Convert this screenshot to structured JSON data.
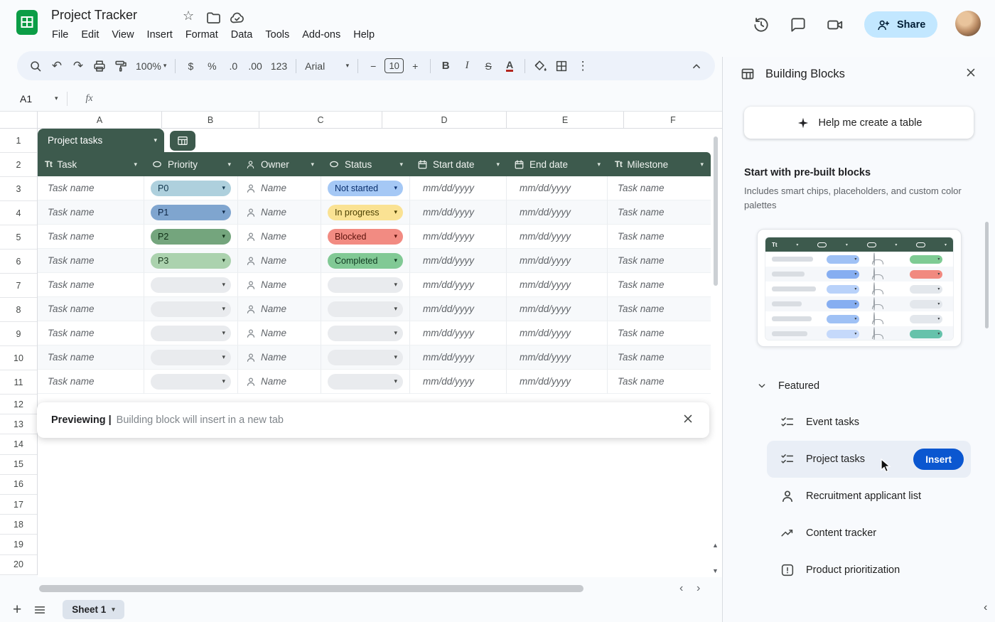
{
  "app": {
    "title": "Project Tracker",
    "menus": [
      "File",
      "Edit",
      "View",
      "Insert",
      "Format",
      "Data",
      "Tools",
      "Add-ons",
      "Help"
    ],
    "share": "Share"
  },
  "toolbar": {
    "zoom": "100%",
    "currency": "$",
    "percent": "%",
    "decrease_decimals": ".0",
    "increase_decimals": ".00",
    "more_formats": "123",
    "font": "Arial",
    "font_size": "10",
    "bold": "B",
    "italic": "I",
    "strikethrough": "S",
    "text_color": "A",
    "more": "⋮",
    "minus": "−",
    "plus": "+"
  },
  "formula_bar": {
    "cell": "A1",
    "fx": "fx"
  },
  "grid": {
    "columns": [
      "A",
      "B",
      "C",
      "D",
      "E",
      "F"
    ],
    "rows": [
      "1",
      "2",
      "3",
      "4",
      "5",
      "6",
      "7",
      "8",
      "9",
      "10",
      "11",
      "12",
      "13",
      "14",
      "15",
      "16",
      "17",
      "18",
      "19",
      "20"
    ]
  },
  "table": {
    "name": "Project tasks",
    "headers": [
      {
        "icon": "text",
        "label": "Task"
      },
      {
        "icon": "chip",
        "label": "Priority"
      },
      {
        "icon": "person",
        "label": "Owner"
      },
      {
        "icon": "chip",
        "label": "Status"
      },
      {
        "icon": "calendar",
        "label": "Start date"
      },
      {
        "icon": "calendar",
        "label": "End date"
      },
      {
        "icon": "text",
        "label": "Milestone"
      }
    ],
    "rows": [
      {
        "task": "Task name",
        "priority": {
          "label": "P0",
          "bg": "#aed0dd",
          "fg": "#12374e"
        },
        "owner": "Name",
        "status": {
          "label": "Not started",
          "bg": "#a5c8f5",
          "fg": "#0a2f6d"
        },
        "start": "mm/dd/yyyy",
        "end": "mm/dd/yyyy",
        "milestone": "Task name"
      },
      {
        "task": "Task name",
        "priority": {
          "label": "P1",
          "bg": "#7fa5cf",
          "fg": "#0e2746"
        },
        "owner": "Name",
        "status": {
          "label": "In progress",
          "bg": "#fae293",
          "fg": "#4a3f00"
        },
        "start": "mm/dd/yyyy",
        "end": "mm/dd/yyyy",
        "milestone": "Task name"
      },
      {
        "task": "Task name",
        "priority": {
          "label": "P2",
          "bg": "#74a57d",
          "fg": "#0f2e16"
        },
        "owner": "Name",
        "status": {
          "label": "Blocked",
          "bg": "#f28b82",
          "fg": "#5c120b"
        },
        "start": "mm/dd/yyyy",
        "end": "mm/dd/yyyy",
        "milestone": "Task name"
      },
      {
        "task": "Task name",
        "priority": {
          "label": "P3",
          "bg": "#abd2ae",
          "fg": "#1b3a1f"
        },
        "owner": "Name",
        "status": {
          "label": "Completed",
          "bg": "#81c995",
          "fg": "#103920"
        },
        "start": "mm/dd/yyyy",
        "end": "mm/dd/yyyy",
        "milestone": "Task name"
      },
      {
        "task": "Task name",
        "priority": {
          "label": "",
          "bg": "#e9ebee",
          "fg": "#444746"
        },
        "owner": "Name",
        "status": {
          "label": "",
          "bg": "#e9ebee",
          "fg": "#444746"
        },
        "start": "mm/dd/yyyy",
        "end": "mm/dd/yyyy",
        "milestone": "Task name"
      },
      {
        "task": "Task name",
        "priority": {
          "label": "",
          "bg": "#e9ebee",
          "fg": "#444746"
        },
        "owner": "Name",
        "status": {
          "label": "",
          "bg": "#e9ebee",
          "fg": "#444746"
        },
        "start": "mm/dd/yyyy",
        "end": "mm/dd/yyyy",
        "milestone": "Task name"
      },
      {
        "task": "Task name",
        "priority": {
          "label": "",
          "bg": "#e9ebee",
          "fg": "#444746"
        },
        "owner": "Name",
        "status": {
          "label": "",
          "bg": "#e9ebee",
          "fg": "#444746"
        },
        "start": "mm/dd/yyyy",
        "end": "mm/dd/yyyy",
        "milestone": "Task name"
      },
      {
        "task": "Task name",
        "priority": {
          "label": "",
          "bg": "#e9ebee",
          "fg": "#444746"
        },
        "owner": "Name",
        "status": {
          "label": "",
          "bg": "#e9ebee",
          "fg": "#444746"
        },
        "start": "mm/dd/yyyy",
        "end": "mm/dd/yyyy",
        "milestone": "Task name"
      },
      {
        "task": "Task name",
        "priority": {
          "label": "",
          "bg": "#e9ebee",
          "fg": "#444746"
        },
        "owner": "Name",
        "status": {
          "label": "",
          "bg": "#e9ebee",
          "fg": "#444746"
        },
        "start": "mm/dd/yyyy",
        "end": "mm/dd/yyyy",
        "milestone": "Task name"
      }
    ],
    "colors": {
      "header_bg": "#3d5a4d",
      "empty_chip": "#e9ebee"
    }
  },
  "toast": {
    "bold": "Previewing |",
    "message": "Building block will insert in a new tab"
  },
  "sheet_bar": {
    "sheet": "Sheet 1"
  },
  "sidebar": {
    "title": "Building Blocks",
    "help_button": "Help me create a table",
    "prebuilt_title": "Start with pre-built blocks",
    "prebuilt_desc": "Includes smart chips, placeholders, and custom color palettes",
    "featured": "Featured",
    "items": [
      {
        "label": "Event tasks",
        "icon": "checklist"
      },
      {
        "label": "Project tasks",
        "icon": "checklist",
        "action": "Insert"
      },
      {
        "label": "Recruitment applicant list",
        "icon": "person"
      },
      {
        "label": "Content tracker",
        "icon": "trending"
      },
      {
        "label": "Product prioritization",
        "icon": "priority"
      }
    ],
    "colors": {
      "insert_button": "#0b57d0",
      "highlight": "#e9eef6"
    }
  }
}
